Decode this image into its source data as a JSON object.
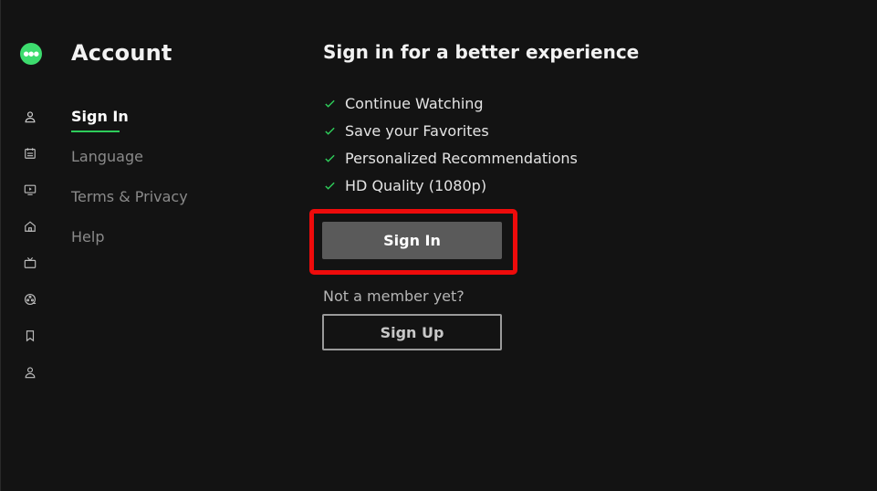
{
  "brand": {
    "logo_icon": "app-logo-icon",
    "accent_color": "#3ddc6e",
    "alert_color": "#ee0b0b"
  },
  "rail": {
    "icons": [
      "user-icon",
      "guide-icon",
      "tv-play-icon",
      "home-icon",
      "live-tv-icon",
      "movies-icon",
      "bookmark-icon",
      "profile-icon"
    ]
  },
  "menu": {
    "title": "Account",
    "items": [
      {
        "label": "Sign In",
        "active": true
      },
      {
        "label": "Language",
        "active": false
      },
      {
        "label": "Terms & Privacy",
        "active": false
      },
      {
        "label": "Help",
        "active": false
      }
    ]
  },
  "main": {
    "headline": "Sign in for a better experience",
    "benefits": [
      "Continue Watching",
      "Save your Favorites",
      "Personalized Recommendations",
      "HD Quality (1080p)"
    ],
    "sign_in_label": "Sign In",
    "not_member_text": "Not a member yet?",
    "sign_up_label": "Sign Up"
  }
}
